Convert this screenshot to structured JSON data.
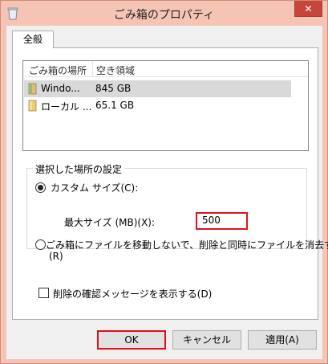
{
  "window": {
    "title": "ごみ箱のプロパティ",
    "close_label": "✕"
  },
  "tabs": [
    {
      "label": "全般"
    }
  ],
  "list": {
    "headers": [
      "ごみ箱の場所",
      "空き領域"
    ],
    "rows": [
      {
        "name": "Windo...",
        "size": "845 GB",
        "selected": true
      },
      {
        "name": "ローカル ...",
        "size": "65.1 GB",
        "selected": false
      }
    ]
  },
  "settings": {
    "group_label": "選択した場所の設定",
    "custom_size_label": "カスタム サイズ(C):",
    "max_size_label": "最大サイズ (MB)(X):",
    "max_size_value": "500",
    "no_move_label_line1": "ごみ箱にファイルを移動しないで、削除と同時にファイルを消去する",
    "no_move_label_line2": "(R)",
    "confirm_delete_label": "削除の確認メッセージを表示する(D)"
  },
  "buttons": {
    "ok": "OK",
    "cancel": "キャンセル",
    "apply": "適用(A)"
  },
  "colors": {
    "title_bar": "#f5c4b4",
    "highlight": "#e0101e"
  }
}
